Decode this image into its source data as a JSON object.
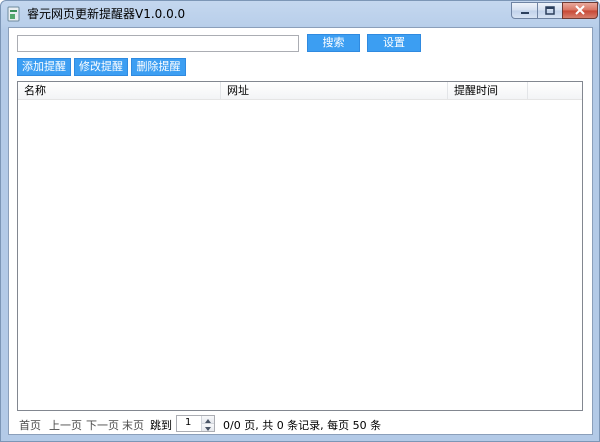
{
  "window": {
    "title": "睿元网页更新提醒器V1.0.0.0"
  },
  "toolbar": {
    "search_placeholder": "",
    "search_value": "",
    "search_label": "搜索",
    "settings_label": "设置",
    "add_label": "添加提醒",
    "edit_label": "修改提醒",
    "delete_label": "删除提醒"
  },
  "table": {
    "columns": [
      "名称",
      "网址",
      "提醒时间",
      ""
    ],
    "rows": []
  },
  "pager": {
    "first": "首页",
    "prev": "上一页",
    "next": "下一页",
    "last": "末页",
    "jump_label": "跳到",
    "page_value": "1",
    "info": "0/0 页, 共 0 条记录, 每页 50 条"
  },
  "icons": {
    "app": "app-icon",
    "minimize": "minimize-icon",
    "maximize": "maximize-icon",
    "close": "close-icon"
  }
}
